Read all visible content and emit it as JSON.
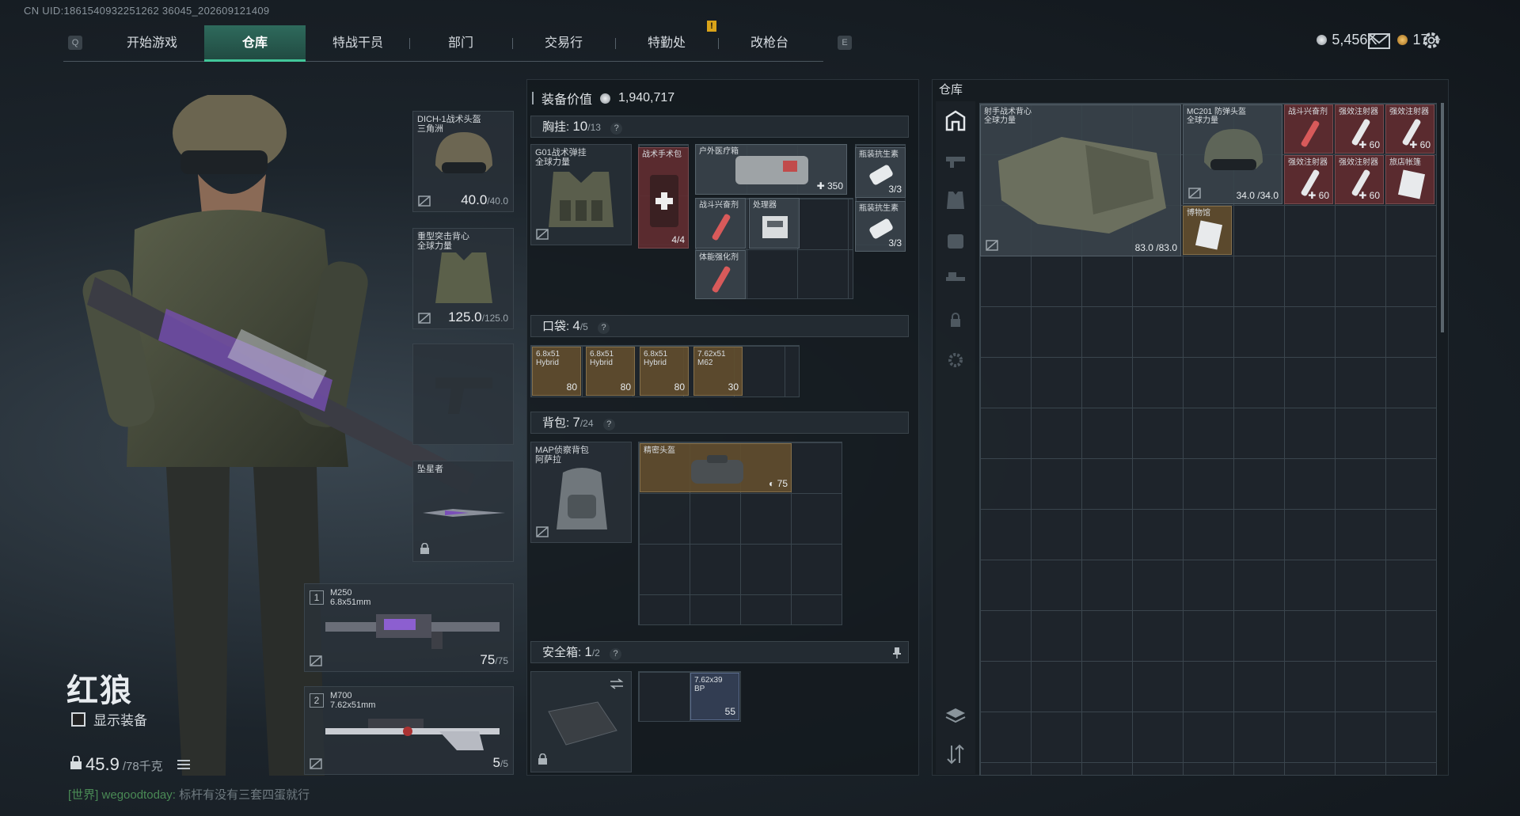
{
  "uid": "CN UID:1861540932251262 36045_202609121409",
  "nav": {
    "key_left": "Q",
    "key_right": "E",
    "tabs": [
      "开始游戏",
      "仓库",
      "特战干员",
      "部门",
      "交易行",
      "特勤处",
      "改枪台"
    ],
    "active": "仓库",
    "alert": "!"
  },
  "currency": {
    "silver": "5,456K",
    "gold": "17",
    "gold_add": "+",
    "silver_color": "#c8ccd0",
    "gold_color": "#d7a03a"
  },
  "operator": {
    "name": "红狼",
    "show_gear_label": "显示装备",
    "weight_value": "45.9",
    "weight_max": "/78千克"
  },
  "chat": {
    "channel": "[世界]",
    "user": "wegoodtoday:",
    "message": "标杆有没有三套四蛋就行"
  },
  "equip": {
    "helmet": {
      "name": "DICH-1战术头盔\n三角洲",
      "dura": "40.0",
      "max": "/40.0"
    },
    "armor": {
      "name": "重型突击背心\n全球力量",
      "dura": "125.0",
      "max": "/125.0"
    },
    "melee": {
      "name": "坠星者"
    },
    "weapon1": {
      "num": "1",
      "name": "M250\n6.8x51mm",
      "ammo": "75",
      "ammo_max": "/75"
    },
    "weapon2": {
      "num": "2",
      "name": "M700\n7.62x51mm",
      "ammo": "5",
      "ammo_max": "/5"
    }
  },
  "loadout": {
    "value_label": "装备价值",
    "value": "1,940,717",
    "chest": {
      "label": "胸挂:",
      "count": "10",
      "max": "/13",
      "help": "?"
    },
    "chest_rig": "G01战术弹挂\n全球力量",
    "chest_items": [
      {
        "name": "战术手术包",
        "count": "4/4"
      },
      {
        "name": "户外医疗箱",
        "count": "350"
      },
      {
        "name": "瓶装抗生素",
        "count": "3/3"
      },
      {
        "name": "战斗兴奋剂",
        "count": ""
      },
      {
        "name": "处理器",
        "count": ""
      },
      {
        "name": "瓶装抗生素",
        "count": "3/3"
      },
      {
        "name": "体能强化剂",
        "count": ""
      }
    ],
    "pocket": {
      "label": "口袋:",
      "count": "4",
      "max": "/5",
      "help": "?"
    },
    "pocket_items": [
      {
        "name": "6.8x51\nHybrid",
        "count": "80"
      },
      {
        "name": "6.8x51\nHybrid",
        "count": "80"
      },
      {
        "name": "6.8x51\nHybrid",
        "count": "80"
      },
      {
        "name": "7.62x51\nM62",
        "count": "30"
      }
    ],
    "backpack": {
      "label": "背包:",
      "count": "7",
      "max": "/24",
      "help": "?"
    },
    "backpack_name": "MAP侦察背包\n阿萨拉",
    "backpack_items": [
      {
        "name": "精密头盔",
        "count": "75"
      }
    ],
    "safe": {
      "label": "安全箱:",
      "count": "1",
      "max": "/2",
      "help": "?"
    },
    "safe_items": [
      {
        "name": "7.62x39\nBP",
        "count": "55"
      }
    ]
  },
  "stash": {
    "title": "仓库",
    "items": [
      {
        "name": "射手战术背心\n全球力量",
        "count": "83.0 /83.0"
      },
      {
        "name": "MC201 防弹头盔\n全球力量",
        "count": "34.0 /34.0"
      },
      {
        "name": "战斗兴奋剂",
        "count": ""
      },
      {
        "name": "强效注射器",
        "count": "60"
      },
      {
        "name": "强效注射器",
        "count": "60"
      },
      {
        "name": "强效注射器",
        "count": "60"
      },
      {
        "name": "强效注射器",
        "count": "60"
      },
      {
        "name": "旅店帐篷",
        "count": ""
      },
      {
        "name": "博物馆",
        "count": ""
      }
    ]
  }
}
